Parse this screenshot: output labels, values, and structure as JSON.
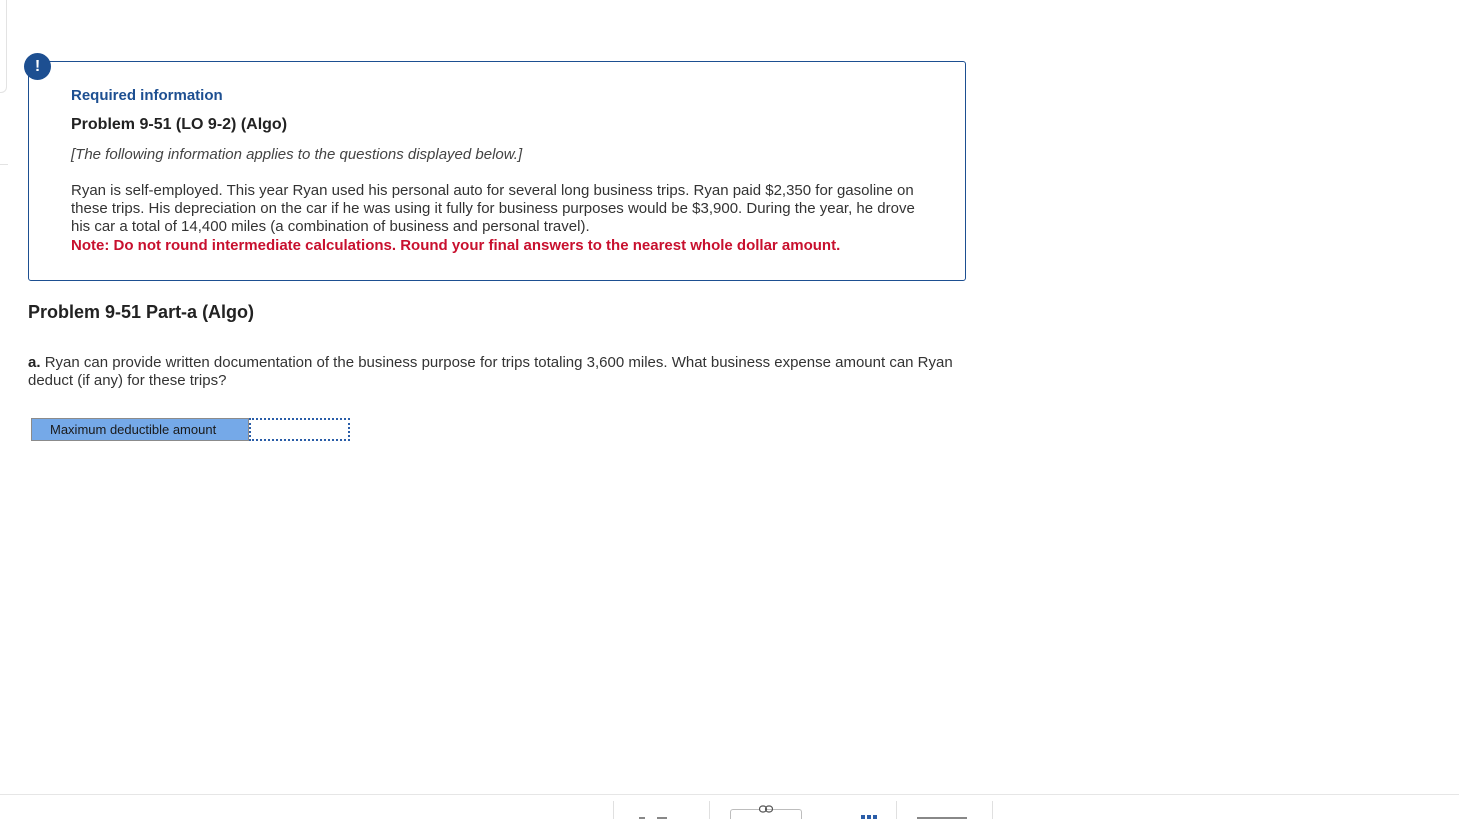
{
  "alert": {
    "symbol": "!"
  },
  "info": {
    "required_title": "Required information",
    "problem_title": "Problem 9-51 (LO 9-2) (Algo)",
    "applies_note": "[The following information applies to the questions displayed below.]",
    "body": "Ryan is self-employed. This year Ryan used his personal auto for several long business trips. Ryan paid $2,350 for gasoline on these trips. His depreciation on the car if he was using it fully for business purposes would be $3,900. During the year, he drove his car a total of 14,400 miles (a combination of business and personal travel).",
    "note": "Note: Do not round intermediate calculations. Round your final answers to the nearest whole dollar amount."
  },
  "part": {
    "title": "Problem 9-51 Part-a (Algo)",
    "question_prefix": "a.",
    "question_text": "Ryan can provide written documentation of the business purpose for trips totaling 3,600 miles. What business expense amount can Ryan deduct (if any) for these trips?"
  },
  "answer": {
    "label": "Maximum deductible amount",
    "value": ""
  },
  "footer": {
    "icons": [
      "link-icon",
      "grid-icon"
    ],
    "colors": {
      "accent": "#1d4f91",
      "note_red": "#c8102e",
      "label_bg": "#75a9e8"
    }
  }
}
